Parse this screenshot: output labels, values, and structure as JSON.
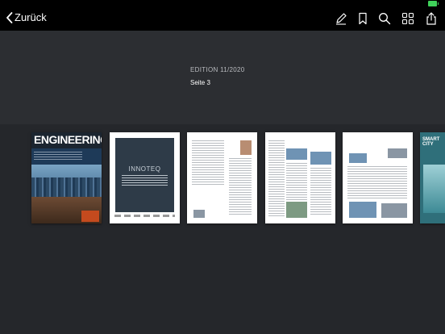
{
  "toolbar": {
    "back_label": "Zurück",
    "icons": [
      "pencil-icon",
      "bookmark-icon",
      "search-icon",
      "grid-icon",
      "share-icon"
    ]
  },
  "header": {
    "edition": "EDITION 11/2020",
    "page_label": "Seite 3"
  },
  "thumbnails": [
    {
      "kind": "cover",
      "masthead": "ENGINEERING"
    },
    {
      "kind": "ad",
      "ad_title": "INNOTEQ"
    },
    {
      "kind": "text-page"
    },
    {
      "kind": "text-page"
    },
    {
      "kind": "text-page"
    },
    {
      "kind": "partial",
      "title": "SMART CITY"
    }
  ],
  "colors": {
    "toolbar_bg": "#000000",
    "header_bg": "#2c2e32",
    "strip_bg": "#25272b",
    "battery": "#3fd25a"
  }
}
